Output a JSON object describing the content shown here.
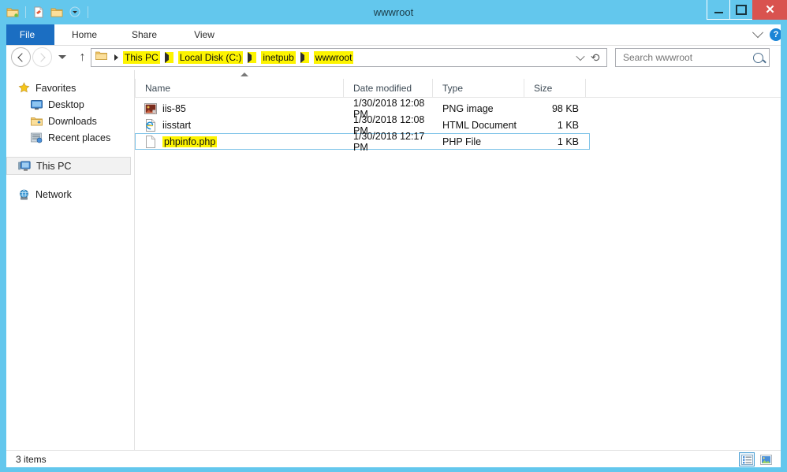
{
  "window": {
    "title": "wwwroot",
    "controls": {
      "minimize": "minimize",
      "maximize": "maximize",
      "close": "✕"
    },
    "accent_blue": "#63c7ed",
    "close_red": "#d9534f",
    "highlight_yellow": "#fdf400"
  },
  "quick_access": {
    "items": [
      {
        "name": "folder-icon",
        "label": "Properties"
      },
      {
        "name": "new-folder-icon",
        "label": "New folder"
      },
      {
        "name": "folder-icon-2",
        "label": "Folder"
      },
      {
        "name": "chevron-down-icon",
        "label": "Customize Quick Access Toolbar"
      }
    ]
  },
  "ribbon": {
    "tabs": [
      {
        "label": "File",
        "active": true
      },
      {
        "label": "Home",
        "active": false
      },
      {
        "label": "Share",
        "active": false
      },
      {
        "label": "View",
        "active": false
      }
    ],
    "minimize_ribbon": "chevron-down-icon",
    "help": "?"
  },
  "navigation": {
    "back": "back-arrow",
    "forward": "forward-arrow",
    "recent": "recent-locations-dropdown",
    "up": "↑",
    "refresh": "⟳",
    "dropdown": "chevron-down-icon"
  },
  "address_bar": {
    "crumbs": [
      "This PC",
      "Local Disk (C:)",
      "inetpub",
      "wwwroot"
    ],
    "highlighted": true
  },
  "search": {
    "placeholder": "Search wwwroot",
    "value": "",
    "icon": "search-icon"
  },
  "sidebar": {
    "groups": [
      {
        "label": "Favorites",
        "icon": "star-icon",
        "items": [
          {
            "label": "Desktop",
            "icon": "desktop-icon"
          },
          {
            "label": "Downloads",
            "icon": "downloads-folder-icon"
          },
          {
            "label": "Recent places",
            "icon": "recent-places-icon"
          }
        ]
      },
      {
        "label": "This PC",
        "icon": "computer-icon",
        "selected": true,
        "items": []
      },
      {
        "label": "Network",
        "icon": "network-icon",
        "items": []
      }
    ]
  },
  "file_list": {
    "columns": [
      {
        "key": "name",
        "label": "Name",
        "sorted": "asc"
      },
      {
        "key": "date",
        "label": "Date modified"
      },
      {
        "key": "type",
        "label": "Type"
      },
      {
        "key": "size",
        "label": "Size"
      }
    ],
    "rows": [
      {
        "name": "iis-85",
        "date": "1/30/2018 12:08 PM",
        "type": "PNG image",
        "size": "98 KB",
        "icon": "png-image-icon",
        "selected": false,
        "highlighted": false
      },
      {
        "name": "iisstart",
        "date": "1/30/2018 12:08 PM",
        "type": "HTML Document",
        "size": "1 KB",
        "icon": "html-document-icon",
        "selected": false,
        "highlighted": false
      },
      {
        "name": "phpinfo.php",
        "date": "1/30/2018 12:17 PM",
        "type": "PHP File",
        "size": "1 KB",
        "icon": "generic-file-icon",
        "selected": true,
        "highlighted": true
      }
    ]
  },
  "status_bar": {
    "item_count": "3 items",
    "views": [
      {
        "name": "details-view",
        "active": true
      },
      {
        "name": "large-icons-view",
        "active": false
      }
    ]
  }
}
